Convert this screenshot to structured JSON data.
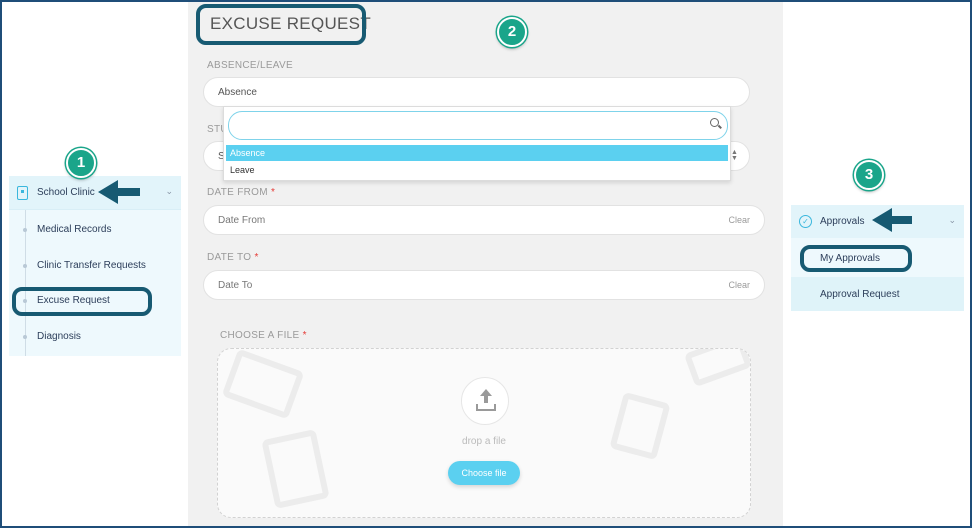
{
  "left_menu": {
    "header": "School Clinic",
    "items": [
      "Medical Records",
      "Clinic Transfer Requests",
      "Excuse Request",
      "Diagnosis"
    ]
  },
  "form": {
    "title": "EXCUSE REQUEST",
    "absence_leave_label": "ABSENCE/LEAVE",
    "absence_leave_value": "Absence",
    "student_label_partial": "STU",
    "student_value_partial": "S",
    "dropdown_options": [
      "Absence",
      "Leave"
    ],
    "dropdown_selected": "Absence",
    "date_from_label": "DATE FROM",
    "date_from_placeholder": "Date From",
    "date_to_label": "DATE TO",
    "date_to_placeholder": "Date To",
    "clear_label": "Clear",
    "required_marker": "*",
    "file_label": "CHOOSE A FILE",
    "drop_text": "drop a file",
    "choose_button": "Choose file"
  },
  "right_menu": {
    "header": "Approvals",
    "items": [
      "My Approvals",
      "Approval Request"
    ]
  },
  "annotations": {
    "badges": [
      "1",
      "2",
      "3"
    ],
    "color_badge": "#1aa58a",
    "color_highlight": "#175a72"
  },
  "colors": {
    "accent": "#5bd0f0",
    "required": "#e53935",
    "panel_bg": "#eef9fd"
  },
  "icons": [
    "clinic-icon",
    "chevron-down-icon",
    "search-icon",
    "sort-arrows-icon",
    "upload-icon",
    "check-circle-icon"
  ]
}
